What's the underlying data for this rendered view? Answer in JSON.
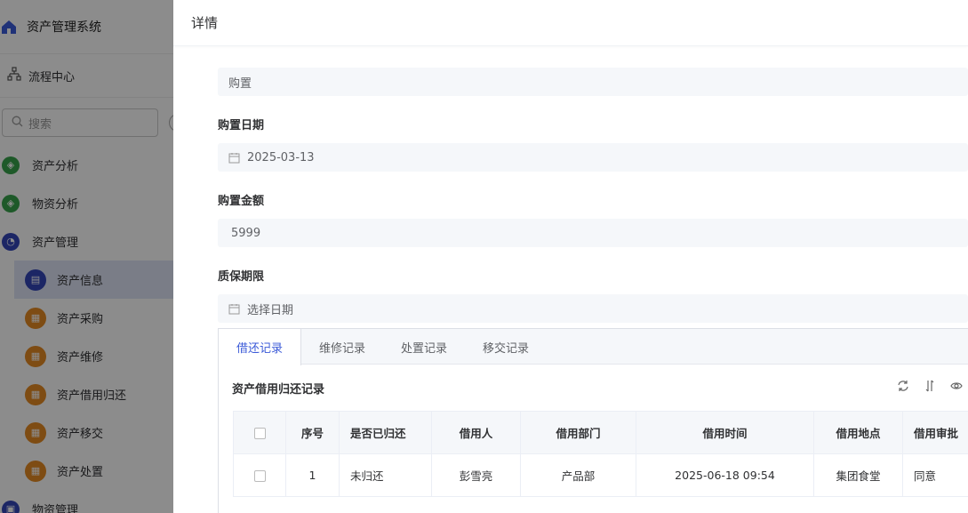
{
  "app": {
    "title": "资产管理系统"
  },
  "sidebar": {
    "flow_label": "流程中心",
    "search_placeholder": "搜索",
    "items": [
      {
        "label": "资产分析",
        "icon": "chart-icon",
        "color": "#37a34b"
      },
      {
        "label": "物资分析",
        "icon": "chart-icon",
        "color": "#37a34b"
      },
      {
        "label": "资产管理",
        "icon": "pie-icon",
        "color": "#3346b8"
      },
      {
        "label": "资产信息",
        "icon": "document-icon",
        "color": "#3346b8"
      },
      {
        "label": "资产采购",
        "icon": "boxes-icon",
        "color": "#e58b23"
      },
      {
        "label": "资产维修",
        "icon": "boxes-icon",
        "color": "#e58b23"
      },
      {
        "label": "资产借用归还",
        "icon": "boxes-icon",
        "color": "#e58b23"
      },
      {
        "label": "资产移交",
        "icon": "boxes-icon",
        "color": "#e58b23"
      },
      {
        "label": "资产处置",
        "icon": "boxes-icon",
        "color": "#e58b23"
      },
      {
        "label": "物资管理",
        "icon": "box-icon",
        "color": "#3346b8"
      }
    ]
  },
  "drawer": {
    "title": "详情",
    "fields": {
      "purchase_type_value": "购置",
      "purchase_date_label": "购置日期",
      "purchase_date_value": "2025-03-13",
      "purchase_amount_label": "购置金额",
      "purchase_amount_value": "5999",
      "warranty_label": "质保期限",
      "warranty_placeholder": "选择日期"
    },
    "tabs": [
      "借还记录",
      "维修记录",
      "处置记录",
      "移交记录"
    ],
    "active_tab": "借还记录",
    "section_title": "资产借用归还记录",
    "table": {
      "headers": [
        "序号",
        "是否已归还",
        "借用人",
        "借用部门",
        "借用时间",
        "借用地点",
        "借用审批"
      ],
      "rows": [
        [
          "1",
          "未归还",
          "彭雪亮",
          "产品部",
          "2025-06-18 09:54",
          "集团食堂",
          "同意"
        ]
      ]
    }
  },
  "colors": {
    "accent": "#3c5bd8",
    "overlay": "rgba(0,0,0,0.45)"
  }
}
